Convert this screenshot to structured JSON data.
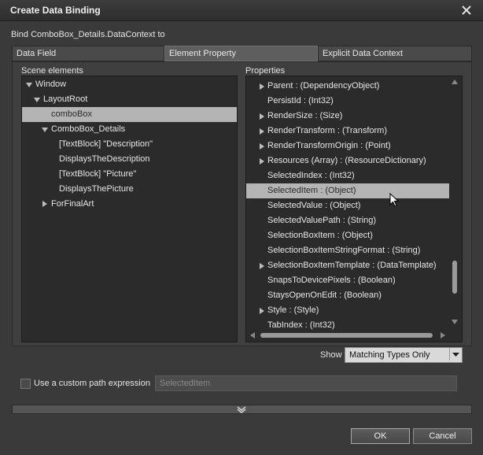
{
  "window": {
    "title": "Create Data Binding"
  },
  "bind_target": "Bind ComboBox_Details.DataContext to",
  "tabs": [
    {
      "label": "Data Field"
    },
    {
      "label": "Element Property",
      "active": true
    },
    {
      "label": "Explicit Data Context"
    }
  ],
  "scene": {
    "heading": "Scene elements",
    "items": [
      {
        "label": "Window",
        "expander": "expanded"
      },
      {
        "label": "LayoutRoot",
        "expander": "expanded"
      },
      {
        "label": "comboBox",
        "selected": true
      },
      {
        "label": "ComboBox_Details",
        "expander": "expanded"
      },
      {
        "label": "[TextBlock] \"Description\""
      },
      {
        "label": "DisplaysTheDescription"
      },
      {
        "label": "[TextBlock] \"Picture\""
      },
      {
        "label": "DisplaysThePicture"
      },
      {
        "label": "ForFinalArt",
        "expander": "collapsed"
      }
    ]
  },
  "properties": {
    "heading": "Properties",
    "items": [
      {
        "label": "Parent : (DependencyObject)",
        "expander": true
      },
      {
        "label": "PersistId : (Int32)"
      },
      {
        "label": "RenderSize : (Size)",
        "expander": true
      },
      {
        "label": "RenderTransform : (Transform)",
        "expander": true
      },
      {
        "label": "RenderTransformOrigin : (Point)",
        "expander": true
      },
      {
        "label": "Resources (Array) : (ResourceDictionary)",
        "expander": true
      },
      {
        "label": "SelectedIndex : (Int32)"
      },
      {
        "label": "SelectedItem : (Object)",
        "selected": true
      },
      {
        "label": "SelectedValue : (Object)"
      },
      {
        "label": "SelectedValuePath : (String)"
      },
      {
        "label": "SelectionBoxItem : (Object)"
      },
      {
        "label": "SelectionBoxItemStringFormat : (String)"
      },
      {
        "label": "SelectionBoxItemTemplate : (DataTemplate)",
        "expander": true
      },
      {
        "label": "SnapsToDevicePixels : (Boolean)"
      },
      {
        "label": "StaysOpenOnEdit : (Boolean)"
      },
      {
        "label": "Style : (Style)",
        "expander": true
      },
      {
        "label": "TabIndex : (Int32)"
      }
    ]
  },
  "show": {
    "label": "Show",
    "value": "Matching Types Only"
  },
  "custom_path": {
    "checkbox_label": "Use a custom path expression",
    "checked": false,
    "input_value": "SelectedItem"
  },
  "buttons": {
    "ok": "OK",
    "cancel": "Cancel"
  },
  "colors": {
    "window_bg": "#3a3a3a",
    "selection": "#b4b4b4",
    "list_bg": "#2b2b2b"
  }
}
